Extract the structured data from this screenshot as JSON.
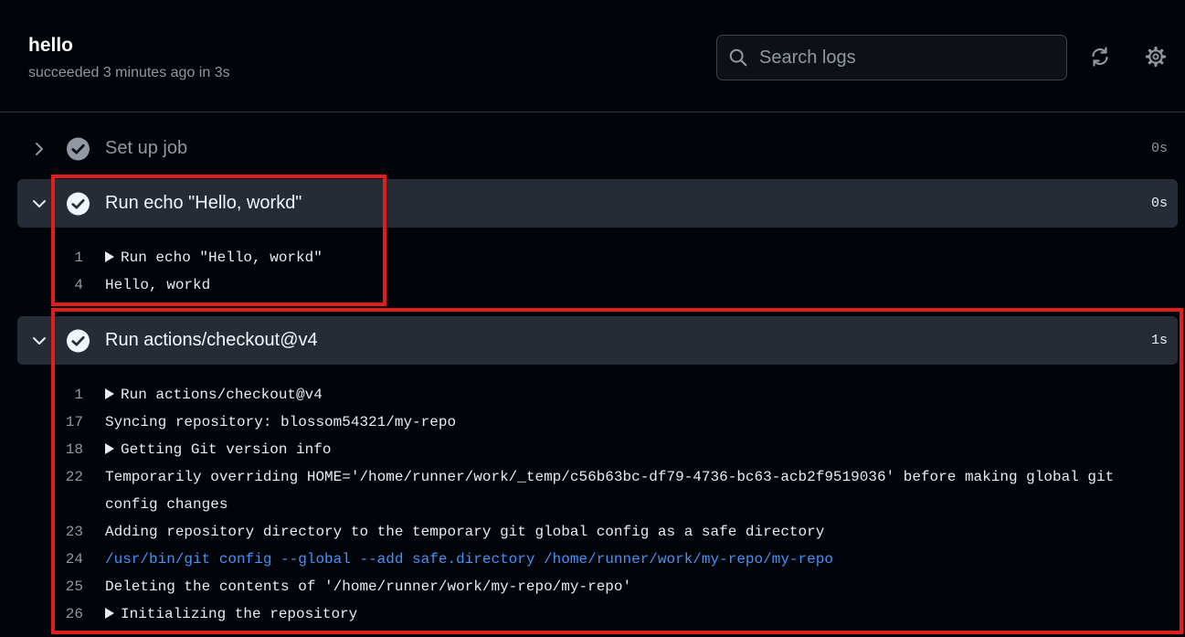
{
  "job": {
    "title": "hello",
    "status": "succeeded 3 minutes ago in 3s"
  },
  "search": {
    "placeholder": "Search logs",
    "value": ""
  },
  "icons": {
    "search": "search-icon",
    "refresh": "refresh-icon",
    "settings": "gear-icon",
    "chevron_right": "chevron-right-icon",
    "chevron_down": "chevron-down-icon",
    "check": "check-circle-icon"
  },
  "colors": {
    "background": "#010409",
    "step_expanded_bg": "#262c36",
    "muted": "#9198a1",
    "command": "#4493f8",
    "highlight": "#e01e1e"
  },
  "steps": [
    {
      "label": "Set up job",
      "duration": "0s",
      "expanded": false
    },
    {
      "label": "Run echo \"Hello, workd\"",
      "duration": "0s",
      "expanded": true
    },
    {
      "label": "Run actions/checkout@v4",
      "duration": "1s",
      "expanded": true
    }
  ],
  "logs": {
    "echo": [
      {
        "num": "1",
        "text": "Run echo \"Hello, workd\"",
        "group": true
      },
      {
        "num": "4",
        "text": "Hello, workd"
      }
    ],
    "checkout": [
      {
        "num": "1",
        "text": "Run actions/checkout@v4",
        "group": true
      },
      {
        "num": "17",
        "text": "Syncing repository: blossom54321/my-repo"
      },
      {
        "num": "18",
        "text": "Getting Git version info",
        "group": true
      },
      {
        "num": "22",
        "text": "Temporarily overriding HOME='/home/runner/work/_temp/c56b63bc-df79-4736-bc63-acb2f9519036' before making global git"
      },
      {
        "num": "",
        "text": "config changes"
      },
      {
        "num": "23",
        "text": "Adding repository directory to the temporary git global config as a safe directory"
      },
      {
        "num": "24",
        "text": "/usr/bin/git config --global --add safe.directory /home/runner/work/my-repo/my-repo",
        "cmd": true
      },
      {
        "num": "25",
        "text": "Deleting the contents of '/home/runner/work/my-repo/my-repo'"
      },
      {
        "num": "26",
        "text": "Initializing the repository",
        "group": true
      }
    ]
  }
}
